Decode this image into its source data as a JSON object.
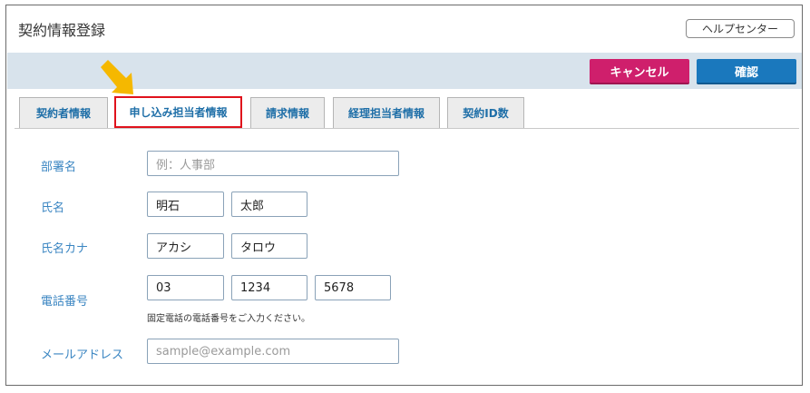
{
  "header": {
    "title": "契約情報登録",
    "help_label": "ヘルプセンター"
  },
  "actions": {
    "cancel_label": "キャンセル",
    "confirm_label": "確認"
  },
  "tabs": [
    {
      "label": "契約者情報"
    },
    {
      "label": "申し込み担当者情報"
    },
    {
      "label": "請求情報"
    },
    {
      "label": "経理担当者情報"
    },
    {
      "label": "契約ID数"
    }
  ],
  "active_tab": "申し込み担当者情報",
  "form": {
    "department": {
      "label": "部署名",
      "placeholder": "例：人事部"
    },
    "name": {
      "label": "氏名",
      "last": "明石",
      "first": "太郎"
    },
    "name_kana": {
      "label": "氏名カナ",
      "last": "アカシ",
      "first": "タロウ"
    },
    "phone": {
      "label": "電話番号",
      "part1": "03",
      "part2": "1234",
      "part3": "5678",
      "note": "固定電話の電話番号をご入力ください。"
    },
    "email": {
      "label": "メールアドレス",
      "placeholder": "sample@example.com"
    }
  },
  "colors": {
    "cancel": "#cf1f6c",
    "confirm": "#1a78bd",
    "highlight": "#e0121c",
    "arrow": "#f5b800",
    "label": "#3b86c2"
  }
}
